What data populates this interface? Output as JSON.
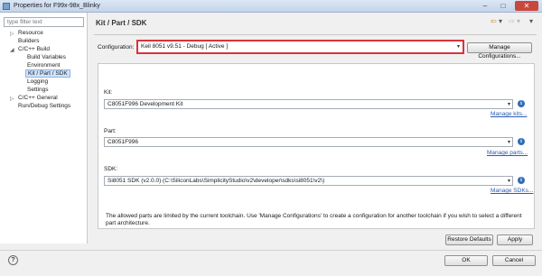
{
  "window": {
    "title": "Properties for F99x-98x_Blinky",
    "minimize": "–",
    "maximize": "□",
    "close": "✕"
  },
  "sidebar": {
    "filter_placeholder": "type filter text",
    "items": [
      {
        "label": "Resource",
        "twisty": "▷"
      },
      {
        "label": "Builders"
      },
      {
        "label": "C/C++ Build",
        "twisty": "◢"
      },
      {
        "label": "Build Variables"
      },
      {
        "label": "Environment"
      },
      {
        "label": "Kit / Part / SDK"
      },
      {
        "label": "Logging"
      },
      {
        "label": "Settings"
      },
      {
        "label": "C/C++ General",
        "twisty": "▷"
      },
      {
        "label": "Run/Debug Settings"
      }
    ]
  },
  "main": {
    "heading": "Kit / Part / SDK",
    "nav": {
      "back": "⇦",
      "forward": "⇨",
      "menu": "▾"
    },
    "configuration": {
      "label": "Configuration:",
      "value": "Keil 8051 v9.51 - Debug  [ Active ]",
      "manage_label": "Manage Configurations..."
    },
    "kit": {
      "label": "Kit:",
      "value": "C8051F996 Development Kit",
      "link": "Manage kits..."
    },
    "part": {
      "label": "Part:",
      "value": "C8051F996",
      "link": "Manage parts..."
    },
    "sdk": {
      "label": "SDK:",
      "value": "Si8051 SDK (v2.0.0) (C:\\SiliconLabs\\SimplicityStudio\\v2\\developer\\sdks\\si8051\\v2\\)",
      "link": "Manage SDKs..."
    },
    "note": "The allowed parts are limited by the current toolchain.  Use 'Manage Configurations' to create a configuration for another toolchain if you wish to select a different part architecture.",
    "restore_defaults": "Restore Defaults",
    "apply": "Apply"
  },
  "footer": {
    "help": "?",
    "ok": "OK",
    "cancel": "Cancel"
  },
  "icons": {
    "info": "i",
    "dropdown": "▾"
  }
}
